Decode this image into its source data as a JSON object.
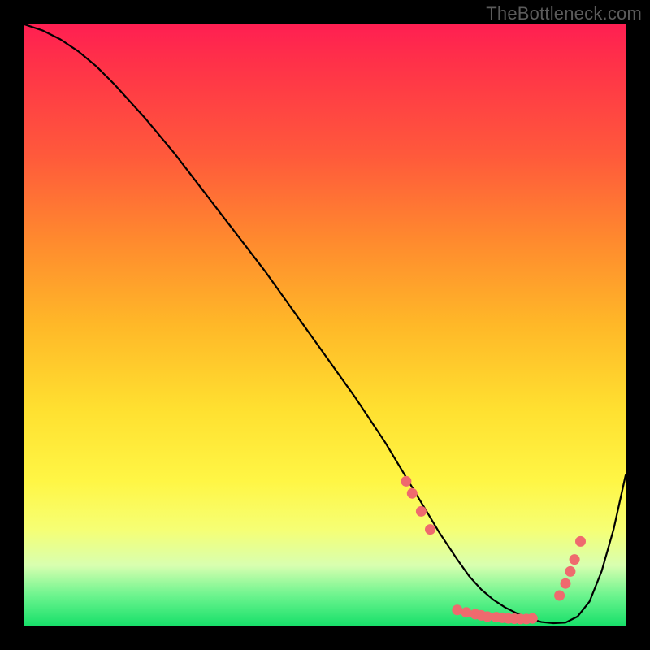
{
  "watermark": "TheBottleneck.com",
  "colors": {
    "gradient_top": "#ff1f52",
    "gradient_mid": "#ffe030",
    "gradient_bottom": "#18e06a",
    "curve": "#000000",
    "dots": "#ef6a6e",
    "frame": "#000000"
  },
  "chart_data": {
    "type": "line",
    "title": "",
    "xlabel": "",
    "ylabel": "",
    "xlim": [
      0,
      100
    ],
    "ylim": [
      0,
      100
    ],
    "grid": false,
    "legend": false,
    "series": [
      {
        "name": "curve",
        "x": [
          0,
          3,
          6,
          9,
          12,
          15,
          20,
          25,
          30,
          35,
          40,
          45,
          50,
          55,
          60,
          63,
          66,
          69,
          72,
          74,
          76,
          78,
          80,
          82,
          84,
          86,
          88,
          90,
          92,
          94,
          96,
          98,
          100
        ],
        "y": [
          100,
          99,
          97.5,
          95.5,
          93,
          90,
          84.5,
          78.5,
          72,
          65.5,
          59,
          52,
          45,
          38,
          30.5,
          25.5,
          20.5,
          15.5,
          11,
          8.2,
          6,
          4.3,
          3,
          2,
          1.2,
          0.6,
          0.4,
          0.5,
          1.5,
          4,
          9,
          16,
          25
        ]
      }
    ],
    "points": [
      {
        "x": 63.5,
        "y": 24
      },
      {
        "x": 64.5,
        "y": 22
      },
      {
        "x": 66,
        "y": 19
      },
      {
        "x": 67.5,
        "y": 16
      },
      {
        "x": 72,
        "y": 2.6
      },
      {
        "x": 73.5,
        "y": 2.2
      },
      {
        "x": 75,
        "y": 1.9
      },
      {
        "x": 76,
        "y": 1.7
      },
      {
        "x": 77,
        "y": 1.5
      },
      {
        "x": 78.5,
        "y": 1.4
      },
      {
        "x": 79.5,
        "y": 1.3
      },
      {
        "x": 80.5,
        "y": 1.2
      },
      {
        "x": 81.5,
        "y": 1.15
      },
      {
        "x": 82.5,
        "y": 1.1
      },
      {
        "x": 83.5,
        "y": 1.1
      },
      {
        "x": 84.5,
        "y": 1.2
      },
      {
        "x": 89,
        "y": 5
      },
      {
        "x": 90,
        "y": 7
      },
      {
        "x": 90.8,
        "y": 9
      },
      {
        "x": 91.5,
        "y": 11
      },
      {
        "x": 92.5,
        "y": 14
      }
    ]
  }
}
